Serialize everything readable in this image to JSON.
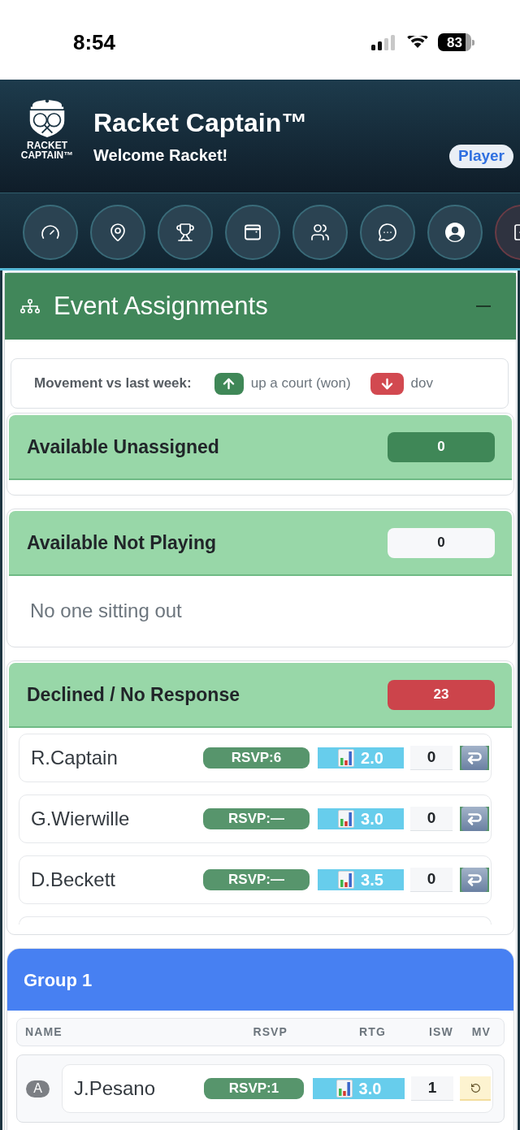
{
  "status_bar": {
    "time": "8:54",
    "battery": "83"
  },
  "header": {
    "logo_lines": [
      "RACKET",
      "CAPTAIN™"
    ],
    "title": "Racket Captain™",
    "subtitle": "Welcome Racket!",
    "role_badge": "Player"
  },
  "panel": {
    "title": "Event Assignments",
    "legend": {
      "label": "Movement vs last week:",
      "items": [
        {
          "kind": "up",
          "text": "up a court (won)"
        },
        {
          "kind": "down",
          "text": "dov"
        }
      ]
    },
    "sections": [
      {
        "title": "Available Unassigned",
        "count": "0",
        "color": "#3f8757"
      },
      {
        "title": "Available Not Playing",
        "count": "0",
        "color": "#f7f8fa",
        "empty_text": "No one sitting out"
      },
      {
        "title": "Declined / No Response",
        "count": "23",
        "color": "#cc444b",
        "players": [
          {
            "name": "R.Captain",
            "rsvp": "RSVP:6",
            "rating": "2.0",
            "isw": "0"
          },
          {
            "name": "G.Wierwille",
            "rsvp": "RSVP:—",
            "rating": "3.0",
            "isw": "0"
          },
          {
            "name": "D.Beckett",
            "rsvp": "RSVP:—",
            "rating": "3.5",
            "isw": "0"
          }
        ]
      }
    ],
    "groups": [
      {
        "title": "Group 1",
        "columns": [
          "NAME",
          "RSVP",
          "RTG",
          "ISW",
          "MV"
        ],
        "players": [
          {
            "court": "A",
            "name": "J.Pesano",
            "rsvp": "RSVP:1",
            "rating": "3.0",
            "isw": "1"
          }
        ]
      }
    ]
  }
}
